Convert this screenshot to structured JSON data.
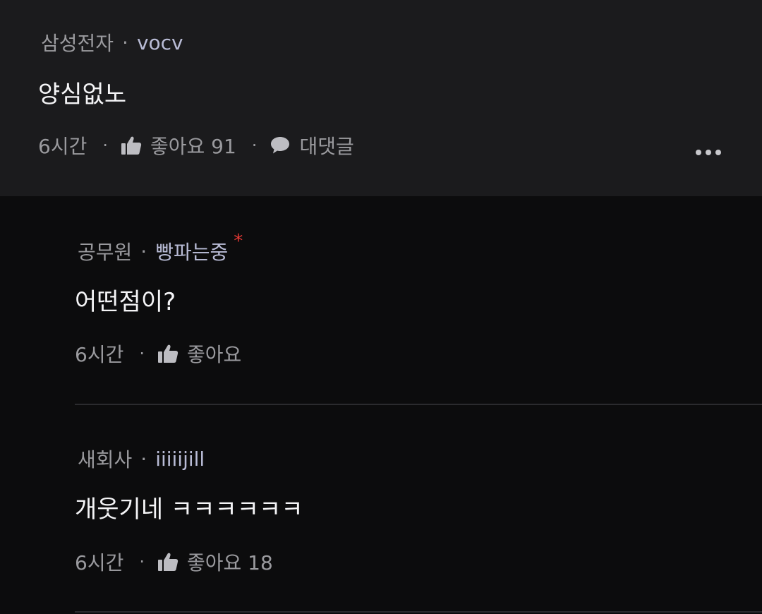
{
  "comment": {
    "company": "삼성전자",
    "nickname": "vocv",
    "text": "양심없노",
    "time": "6시간",
    "like_label": "좋아요 91",
    "reply_label": "대댓글"
  },
  "replies": [
    {
      "company": "공무원",
      "nickname": "빵파는중",
      "marker": "*",
      "text": "어떤점이?",
      "time": "6시간",
      "like_label": "좋아요"
    },
    {
      "company": "새회사",
      "nickname": "iiiiijill",
      "text": "개웃기네 ㅋㅋㅋㅋㅋㅋ",
      "time": "6시간",
      "like_label": "좋아요 18"
    }
  ],
  "separator": "·",
  "icons": {
    "like": "thumbs-up-icon",
    "reply": "speech-bubble-icon",
    "more": "more-dots-icon"
  }
}
